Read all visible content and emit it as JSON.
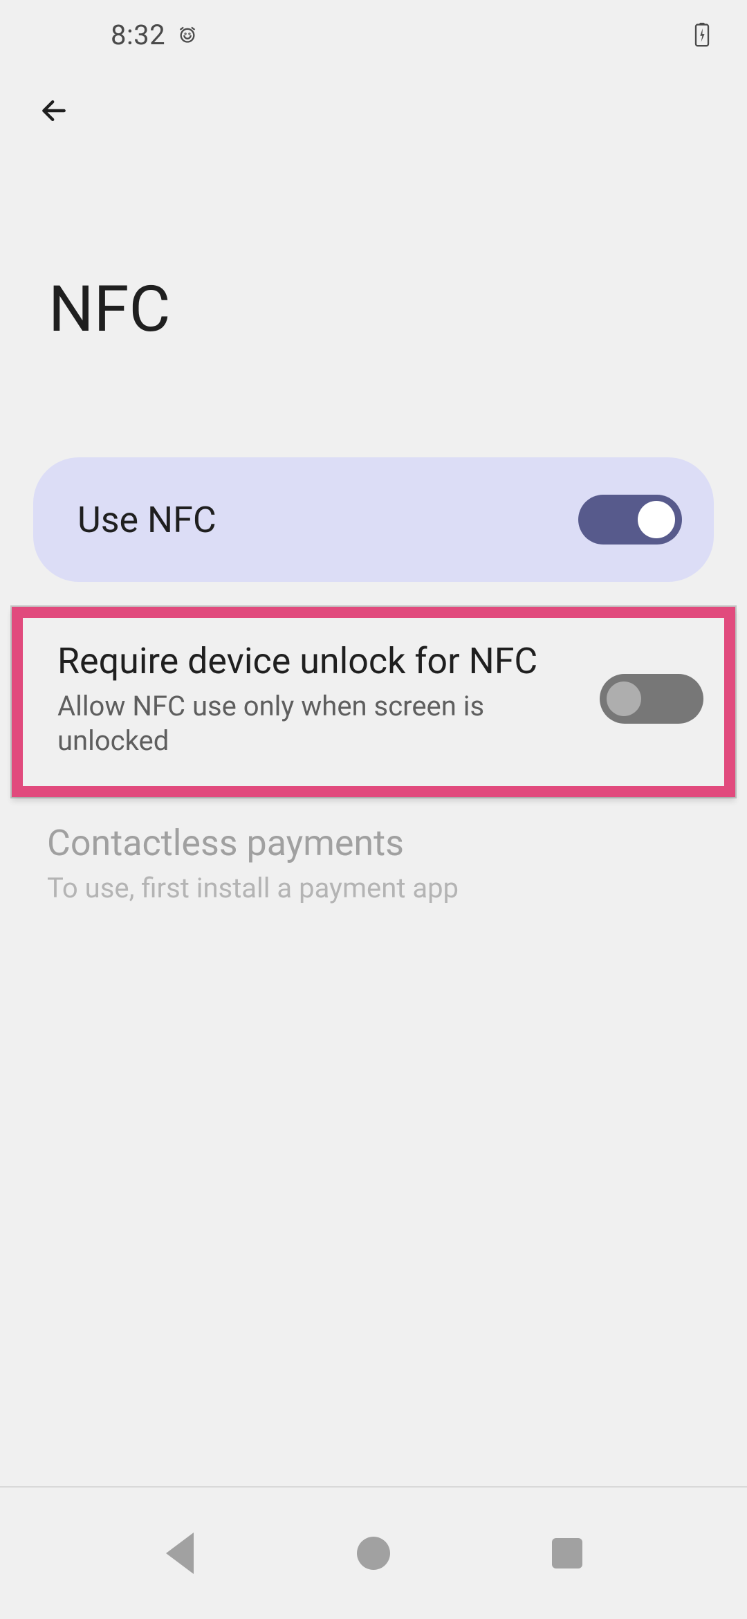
{
  "status": {
    "time": "8:32"
  },
  "page": {
    "title": "NFC"
  },
  "items": {
    "use_nfc": {
      "label": "Use NFC",
      "toggle_on": true
    },
    "require_unlock": {
      "label": "Require device unlock for NFC",
      "sub": "Allow NFC use only when screen is unlocked",
      "toggle_on": false
    },
    "contactless": {
      "label": "Contactless payments",
      "sub": "To use, first install a payment app",
      "enabled": false
    }
  }
}
